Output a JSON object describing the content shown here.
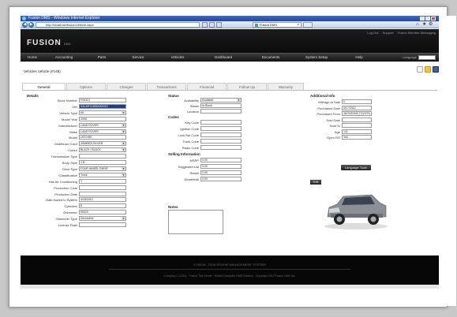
{
  "browser": {
    "title": "Fusion DMS - Windows Internet Explorer",
    "address": "http://localhost/fusion/vehicle.aspx",
    "tab_title": "Fusion DMS"
  },
  "app": {
    "top_links": [
      "Log Out",
      "Support",
      "Fusion Member Messaging"
    ],
    "logo": "FUSION",
    "logo_sub": "DMS",
    "menu": [
      "Home",
      "Accounting",
      "Parts",
      "Service",
      "Vehicles",
      "Dashboard",
      "Documents",
      "System Setup",
      "Help"
    ],
    "lang_label": "Language"
  },
  "breadcrumb": "Vehicles  Vehicle (#148)",
  "tabs": [
    "General",
    "Options",
    "Charges",
    "Transactions",
    "Financial",
    "Follow Up",
    "Warranty"
  ],
  "sections": {
    "details": "Details",
    "status": "Status",
    "codes": "Codes",
    "selling": "Selling Information",
    "notes": "Notes",
    "additional": "Additional Info"
  },
  "details": [
    {
      "label": "Stock Number",
      "value": "P00321"
    },
    {
      "label": "VIN",
      "value": "SALMF11485A000001"
    },
    {
      "label": "Vehicle Type",
      "value": "All"
    },
    {
      "label": "Model Year",
      "value": "2005"
    },
    {
      "label": "Manufacturer",
      "value": "LAND ROVER"
    },
    {
      "label": "Make",
      "value": "LAND ROVER"
    },
    {
      "label": "Model",
      "value": "LR3 HSE"
    },
    {
      "label": "Distributor Color",
      "value": "ZAMBEZI SILVER"
    },
    {
      "label": "Colour",
      "value": "BLACK / BLACK"
    },
    {
      "label": "Transmission Type",
      "value": ""
    },
    {
      "label": "Body Style",
      "value": "4 D"
    },
    {
      "label": "Drive Type",
      "value": "FOUR WHEEL DRIVE"
    },
    {
      "label": "Classification",
      "value": "Truck"
    },
    {
      "label": "Has Air Conditioning",
      "value": "Y"
    },
    {
      "label": "Production Code",
      "value": ""
    },
    {
      "label": "Production Date",
      "value": ""
    },
    {
      "label": "Date Added to System",
      "value": "4/18/2012"
    },
    {
      "label": "Cylinders",
      "value": "8"
    },
    {
      "label": "Odometer",
      "value": "55423"
    },
    {
      "label": "Odometer Type",
      "value": "Kilometres"
    },
    {
      "label": "License Plate",
      "value": ""
    }
  ],
  "status": [
    {
      "label": "Availability",
      "value": "Available"
    },
    {
      "label": "Status",
      "value": "In Stock"
    },
    {
      "label": "Location",
      "value": ""
    }
  ],
  "codes": [
    {
      "label": "Key Code",
      "value": ""
    },
    {
      "label": "Ignition Code",
      "value": ""
    },
    {
      "label": "Lock Nut Code",
      "value": ""
    },
    {
      "label": "Trunk Code",
      "value": ""
    },
    {
      "label": "Radio Code",
      "value": ""
    }
  ],
  "selling": [
    {
      "label": "MSRP",
      "value": "0.00"
    },
    {
      "label": "Suggested List",
      "value": "0.00"
    },
    {
      "label": "Retain",
      "value": "0.00"
    },
    {
      "label": "Dealertrak",
      "value": "0.00"
    }
  ],
  "additional": [
    {
      "label": "Mileage at Sale",
      "value": "0"
    },
    {
      "label": "Purchased Date",
      "value": "4/17/2012"
    },
    {
      "label": "Purchased From",
      "value": "JACKSONS TOYOTA"
    },
    {
      "label": "Sold Date",
      "value": ""
    },
    {
      "label": "Sold To",
      "value": ""
    },
    {
      "label": "Age",
      "value": "141"
    },
    {
      "label": "Open RO",
      "value": "Yes"
    }
  ],
  "buttons": {
    "language": "Language Tools",
    "edit": "Edit"
  },
  "footer": {
    "line1": "FUSION - DEALERSHIP MANAGEMENT SYSTEM",
    "line2": "Company 1 (1234) · Fusion Test Server · Dealer Computer DMS Solution · Copyright 2012 Fusion DMS Inc."
  },
  "colors": {
    "header": "#0a0a0a",
    "selected_field": "#1a3f9b",
    "accent_button": "#333333"
  }
}
